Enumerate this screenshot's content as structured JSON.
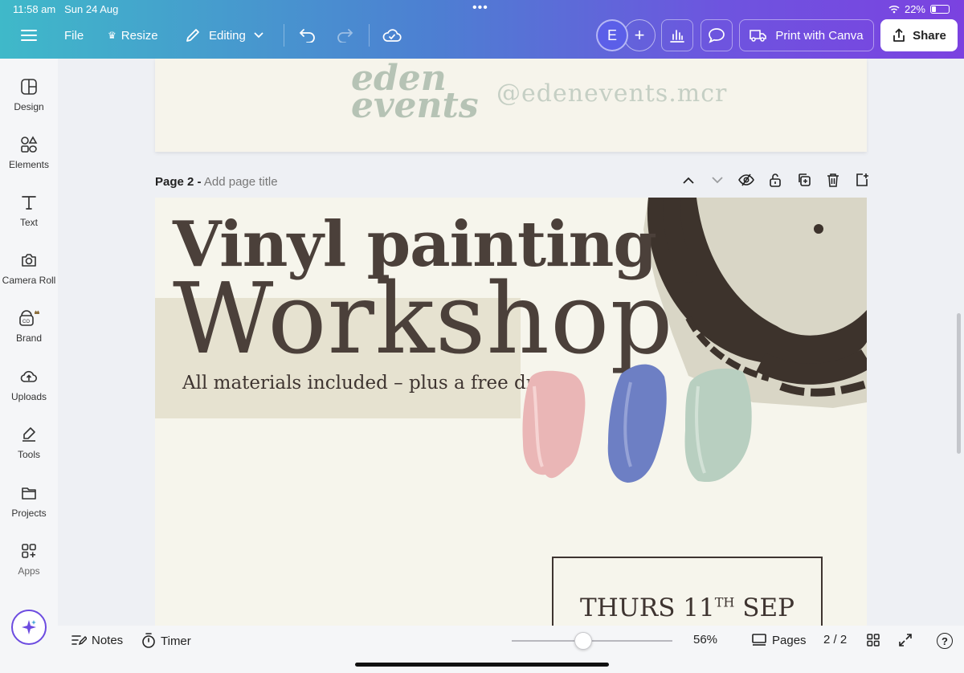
{
  "status": {
    "time": "11:58 am",
    "date": "Sun 24 Aug",
    "battery": "22%"
  },
  "topbar": {
    "file": "File",
    "resize": "Resize",
    "editing": "Editing",
    "avatar_initial": "E",
    "print": "Print with Canva",
    "share": "Share"
  },
  "sidebar": {
    "items": [
      {
        "label": "Design",
        "icon": "design-icon"
      },
      {
        "label": "Elements",
        "icon": "elements-icon"
      },
      {
        "label": "Text",
        "icon": "text-icon"
      },
      {
        "label": "Camera Roll",
        "icon": "camera-icon"
      },
      {
        "label": "Brand",
        "icon": "brand-icon"
      },
      {
        "label": "Uploads",
        "icon": "uploads-icon"
      },
      {
        "label": "Tools",
        "icon": "tools-icon"
      },
      {
        "label": "Projects",
        "icon": "folder-icon"
      },
      {
        "label": "Apps",
        "icon": "apps-icon"
      }
    ]
  },
  "page1": {
    "logo_line1": "eden",
    "logo_line2": "events",
    "handle": "@edenevents.mcr"
  },
  "page2": {
    "label": "Page 2 -",
    "title_placeholder": "Add page title",
    "headline": "Vinyl painting",
    "headline2": "Workshop",
    "subtitle": "All materials included – plus a free drink",
    "date_main": "THURS 11",
    "date_sup": "TH",
    "date_month": "SEP",
    "colors": {
      "pink": "#eab6b6",
      "blue": "#6d7fc4",
      "sage": "#b8cfc0",
      "ink": "#3d332c"
    }
  },
  "bottombar": {
    "notes": "Notes",
    "timer": "Timer",
    "zoom": "56%",
    "pages": "Pages",
    "page_count": "2 / 2",
    "help": "?"
  }
}
